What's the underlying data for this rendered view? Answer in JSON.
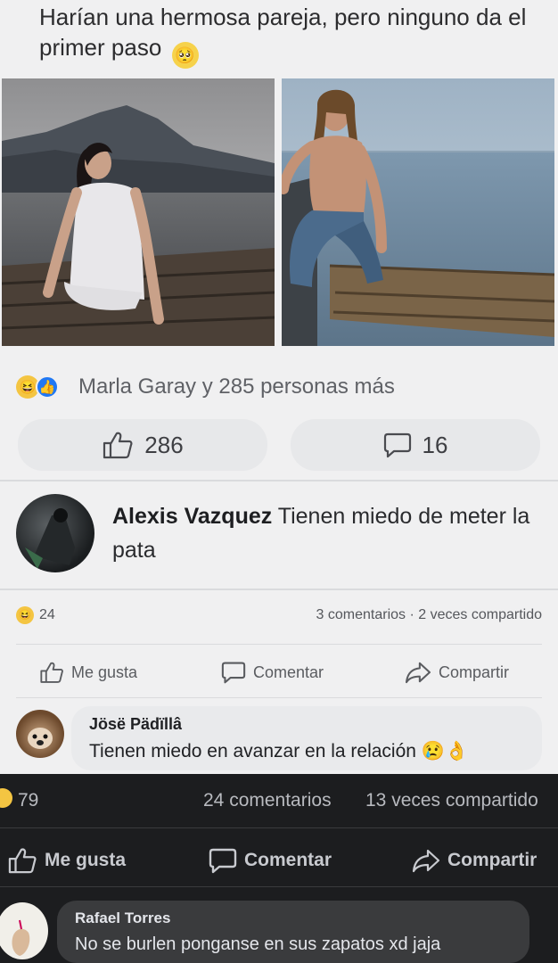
{
  "post": {
    "text": "Harían una hermosa pareja, pero ninguno da el primer paso",
    "emoji": "🥺"
  },
  "reactions": {
    "summary": "Marla Garay y 285 personas más",
    "haha_icon": "😆",
    "like_icon": "👍"
  },
  "buttons": {
    "like_count": "286",
    "comment_count": "16"
  },
  "top_comment": {
    "author": "Alexis Vazquez",
    "text": "Tienen miedo de meter la pata"
  },
  "shared_post": {
    "reaction_count": "24",
    "summary": "3 comentarios · 2 veces compartido",
    "actions": {
      "like": "Me gusta",
      "comment": "Comentar",
      "share": "Compartir"
    }
  },
  "reply_light": {
    "author": "Jösë Pädïllâ",
    "text": "Tienen miedo en avanzar en la relación",
    "emojis": "😢👌"
  },
  "outer_post": {
    "reaction_count": "79",
    "comments": "24 comentarios",
    "shares": "13 veces compartido",
    "actions": {
      "like": "Me gusta",
      "comment": "Comentar",
      "share": "Compartir"
    }
  },
  "reply_dark": {
    "author": "Rafael Torres",
    "text": "No se burlen ponganse en sus zapatos xd jaja"
  },
  "colors": {
    "like_blue": "#2078f4",
    "haha_yellow": "#f4c542",
    "dark_bg": "#1c1d1f"
  }
}
